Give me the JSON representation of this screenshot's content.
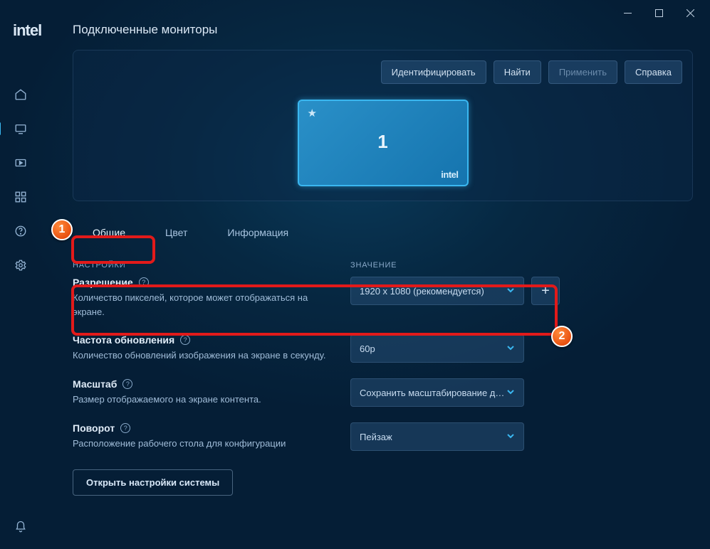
{
  "logo": "intel",
  "page_title": "Подключенные мониторы",
  "buttons": {
    "identify": "Идентифицировать",
    "find": "Найти",
    "apply": "Применить",
    "help": "Справка"
  },
  "monitor": {
    "number": "1",
    "brand": "intel"
  },
  "tabs": {
    "general": "Общие",
    "color": "Цвет",
    "info": "Информация"
  },
  "headers": {
    "settings": "НАСТРОЙКИ",
    "value": "ЗНАЧЕНИЕ"
  },
  "settings": {
    "resolution": {
      "title": "Разрешение",
      "desc": "Количество пикселей, которое может отображаться на экране.",
      "value": "1920 x 1080 (рекомендуется)"
    },
    "refresh": {
      "title": "Частота обновления",
      "desc": "Количество обновлений изображения на экране в секунду.",
      "value": "60p"
    },
    "scale": {
      "title": "Масштаб",
      "desc": "Размер отображаемого на экране контента.",
      "value": "Сохранить масштабирование ди..."
    },
    "rotation": {
      "title": "Поворот",
      "desc": "Расположение рабочего стола для конфигурации",
      "value": "Пейзаж"
    }
  },
  "sys_button": "Открыть настройки системы",
  "markers": {
    "one": "1",
    "two": "2"
  }
}
